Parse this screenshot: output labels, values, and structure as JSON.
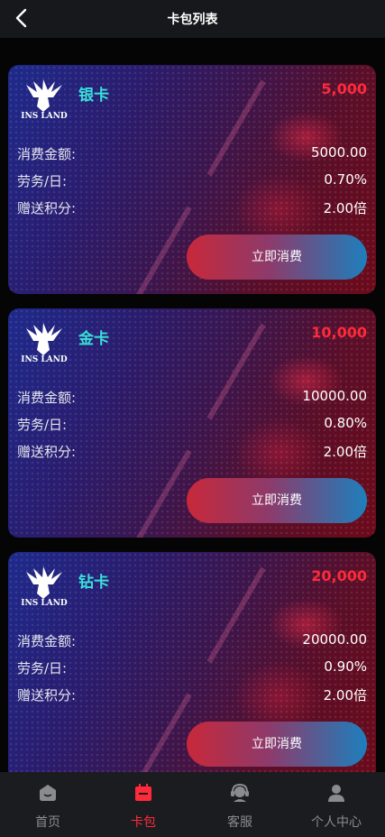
{
  "header": {
    "title": "卡包列表"
  },
  "logo_text": "INS LAND",
  "labels": {
    "amount": "消费金额:",
    "rate": "劳务/日:",
    "points": "赠送积分:"
  },
  "cards": [
    {
      "name": "银卡",
      "price": "5,000",
      "amount": "5000.00",
      "rate": "0.70%",
      "points": "2.00倍",
      "button": "立即消费"
    },
    {
      "name": "金卡",
      "price": "10,000",
      "amount": "10000.00",
      "rate": "0.80%",
      "points": "2.00倍",
      "button": "立即消费"
    },
    {
      "name": "钻卡",
      "price": "20,000",
      "amount": "20000.00",
      "rate": "0.90%",
      "points": "2.00倍",
      "button": "立即消费"
    }
  ],
  "tabs": [
    {
      "label": "首页",
      "icon": "home-icon",
      "active": false
    },
    {
      "label": "卡包",
      "icon": "wallet-icon",
      "active": true
    },
    {
      "label": "客服",
      "icon": "support-icon",
      "active": false
    },
    {
      "label": "个人中心",
      "icon": "user-icon",
      "active": false
    }
  ],
  "colors": {
    "accent": "#ff2a3a",
    "card_name": "#39e0d8",
    "button_start": "#c8283a",
    "button_end": "#1d7fbd"
  }
}
